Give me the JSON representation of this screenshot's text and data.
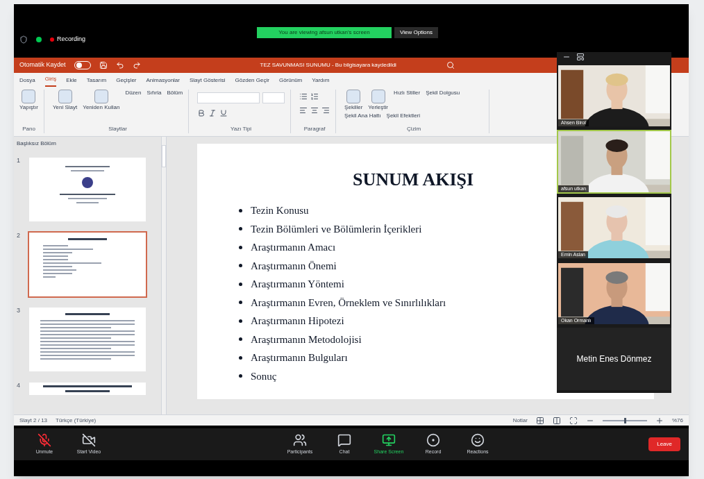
{
  "zoom_top": {
    "recording": "Recording",
    "banner": "You are viewing afsun utkan's screen",
    "view_options": "View Options"
  },
  "powerpoint": {
    "autosave_label": "Otomatik Kaydet",
    "autosave_on": false,
    "file_title": "TEZ SAVUNMASI SUNUMU - Bu bilgisayara kaydedildi",
    "tabs": [
      {
        "label": "Dosya",
        "selected": false
      },
      {
        "label": "Giriş",
        "selected": true
      },
      {
        "label": "Ekle",
        "selected": false
      },
      {
        "label": "Tasarım",
        "selected": false
      },
      {
        "label": "Geçişler",
        "selected": false
      },
      {
        "label": "Animasyonlar",
        "selected": false
      },
      {
        "label": "Slayt Gösterisi",
        "selected": false
      },
      {
        "label": "Gözden Geçir",
        "selected": false
      },
      {
        "label": "Görünüm",
        "selected": false
      },
      {
        "label": "Yardım",
        "selected": false
      }
    ],
    "ribbon_groups": [
      {
        "label": "Pano",
        "items": [
          "Yapıştır"
        ]
      },
      {
        "label": "Slaytlar",
        "items": [
          "Yeni Slayt",
          "Yeniden Kullan",
          "Düzen",
          "Sıfırla",
          "Bölüm"
        ]
      },
      {
        "label": "Yazı Tipi"
      },
      {
        "label": "Paragraf"
      },
      {
        "label": "Çizim",
        "items": [
          "Şekiller",
          "Yerleştir",
          "Hızlı Stiller",
          "Şekil Dolgusu",
          "Şekil Ana Hattı",
          "Şekil Efektleri"
        ]
      }
    ],
    "section": "Başlıksız Bölüm",
    "thumbnails": [
      {
        "number": "1",
        "kind": "title",
        "selected": false
      },
      {
        "number": "2",
        "kind": "bullets",
        "selected": true
      },
      {
        "number": "3",
        "kind": "text",
        "selected": false
      },
      {
        "number": "4",
        "kind": "heading",
        "selected": false
      }
    ],
    "slide": {
      "title": "SUNUM AKIŞI",
      "bullets": [
        "Tezin Konusu",
        "Tezin Bölümleri ve Bölümlerin İçerikleri",
        "Araştırmanın Amacı",
        "Araştırmanın Önemi",
        "Araştırmanın Yöntemi",
        "Araştırmanın Evren, Örneklem ve Sınırlılıkları",
        "Araştırmanın Hipotezi",
        "Araştırmanın Metodolojisi",
        "Araştırmanın Bulguları",
        "Sonuç"
      ]
    },
    "status": {
      "slide_count": "Slayt 2 / 13",
      "language": "Türkçe (Türkiye)",
      "notes": "Notlar",
      "zoom": "%76",
      "zoom_slider": {
        "level": 0.5
      }
    }
  },
  "participants": [
    {
      "name": "Ahsen Birol",
      "kind": "video",
      "speaking": false
    },
    {
      "name": "afsun utkan",
      "kind": "video",
      "speaking": true
    },
    {
      "name": "Emin Aslan",
      "kind": "video",
      "speaking": false
    },
    {
      "name": "Okan Ormanlı",
      "kind": "video",
      "speaking": false
    },
    {
      "name": "Metin Enes Dönmez",
      "kind": "name_only",
      "speaking": false
    }
  ],
  "toolbar": [
    {
      "label": "Unmute",
      "kind": "mic",
      "active": false
    },
    {
      "label": "Start Video",
      "kind": "video",
      "active": false
    },
    {
      "label": "Participants",
      "kind": "participants",
      "active": false
    },
    {
      "label": "Chat",
      "kind": "chat",
      "active": false
    },
    {
      "label": "Share Screen",
      "kind": "share",
      "active": true
    },
    {
      "label": "Record",
      "kind": "record",
      "active": false
    },
    {
      "label": "Reactions",
      "kind": "reactions",
      "active": false
    }
  ],
  "leave": "Leave"
}
